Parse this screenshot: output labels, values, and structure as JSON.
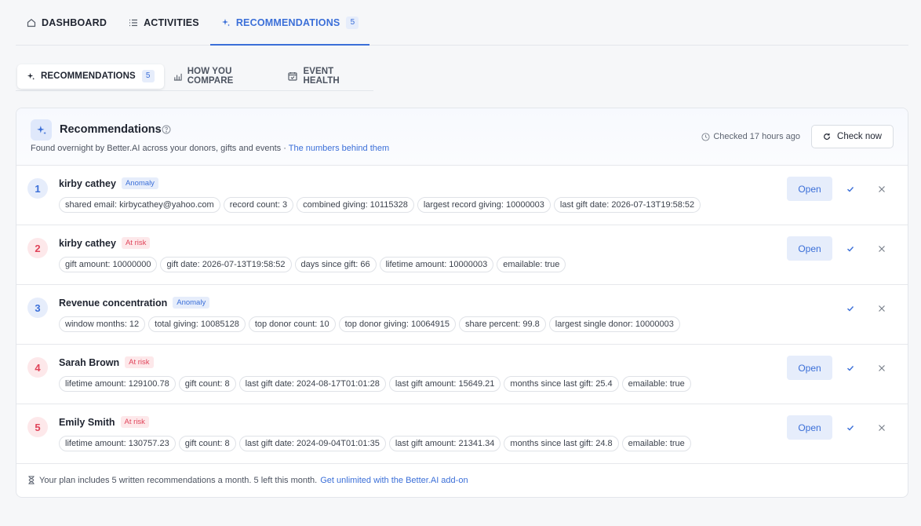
{
  "nav": {
    "tabs": [
      {
        "label": "DASHBOARD",
        "icon": "home-icon"
      },
      {
        "label": "ACTIVITIES",
        "icon": "list-icon"
      },
      {
        "label": "RECOMMENDATIONS",
        "icon": "sparkle-icon",
        "count": "5",
        "active": true
      }
    ]
  },
  "subnav": {
    "tabs": [
      {
        "label": "RECOMMENDATIONS",
        "icon": "sparkle-icon",
        "count": "5",
        "active": true
      },
      {
        "label": "HOW YOU COMPARE",
        "icon": "bar-chart-icon"
      },
      {
        "label": "EVENT HEALTH",
        "icon": "calendar-check-icon"
      }
    ]
  },
  "card": {
    "title": "Recommendations",
    "subtitle": "Found overnight by Better.AI across your donors, gifts and events · ",
    "subtitle_link": "The numbers behind them",
    "checked": "Checked 17 hours ago",
    "check_now": "Check now"
  },
  "recommendations": [
    {
      "num": "1",
      "num_color": "blue",
      "title": "kirby cathey",
      "tag": "Anomaly",
      "tag_type": "anomaly",
      "has_open": true,
      "chips": [
        "shared email: kirbycathey@yahoo.com",
        "record count: 3",
        "combined giving: 10115328",
        "largest record giving: 10000003",
        "last gift date: 2026-07-13T19:58:52"
      ]
    },
    {
      "num": "2",
      "num_color": "red",
      "title": "kirby cathey",
      "tag": "At risk",
      "tag_type": "risk",
      "has_open": true,
      "chips": [
        "gift amount: 10000000",
        "gift date: 2026-07-13T19:58:52",
        "days since gift: 66",
        "lifetime amount: 10000003",
        "emailable: true"
      ]
    },
    {
      "num": "3",
      "num_color": "blue",
      "title": "Revenue concentration",
      "tag": "Anomaly",
      "tag_type": "anomaly",
      "has_open": false,
      "chips": [
        "window months: 12",
        "total giving: 10085128",
        "top donor count: 10",
        "top donor giving: 10064915",
        "share percent: 99.8",
        "largest single donor: 10000003"
      ]
    },
    {
      "num": "4",
      "num_color": "red",
      "title": "Sarah Brown",
      "tag": "At risk",
      "tag_type": "risk",
      "has_open": true,
      "chips": [
        "lifetime amount: 129100.78",
        "gift count: 8",
        "last gift date: 2024-08-17T01:01:28",
        "last gift amount: 15649.21",
        "months since last gift: 25.4",
        "emailable: true"
      ]
    },
    {
      "num": "5",
      "num_color": "red",
      "title": "Emily Smith",
      "tag": "At risk",
      "tag_type": "risk",
      "has_open": true,
      "chips": [
        "lifetime amount: 130757.23",
        "gift count: 8",
        "last gift date: 2024-09-04T01:01:35",
        "last gift amount: 21341.34",
        "months since last gift: 24.8",
        "emailable: true"
      ]
    }
  ],
  "open_label": "Open",
  "footer": {
    "text": "Your plan includes 5 written recommendations a month. 5 left this month.",
    "link": "Get unlimited with the Better.AI add-on"
  },
  "colors": {
    "accent": "#3b6fd8",
    "risk": "#e0445a"
  }
}
